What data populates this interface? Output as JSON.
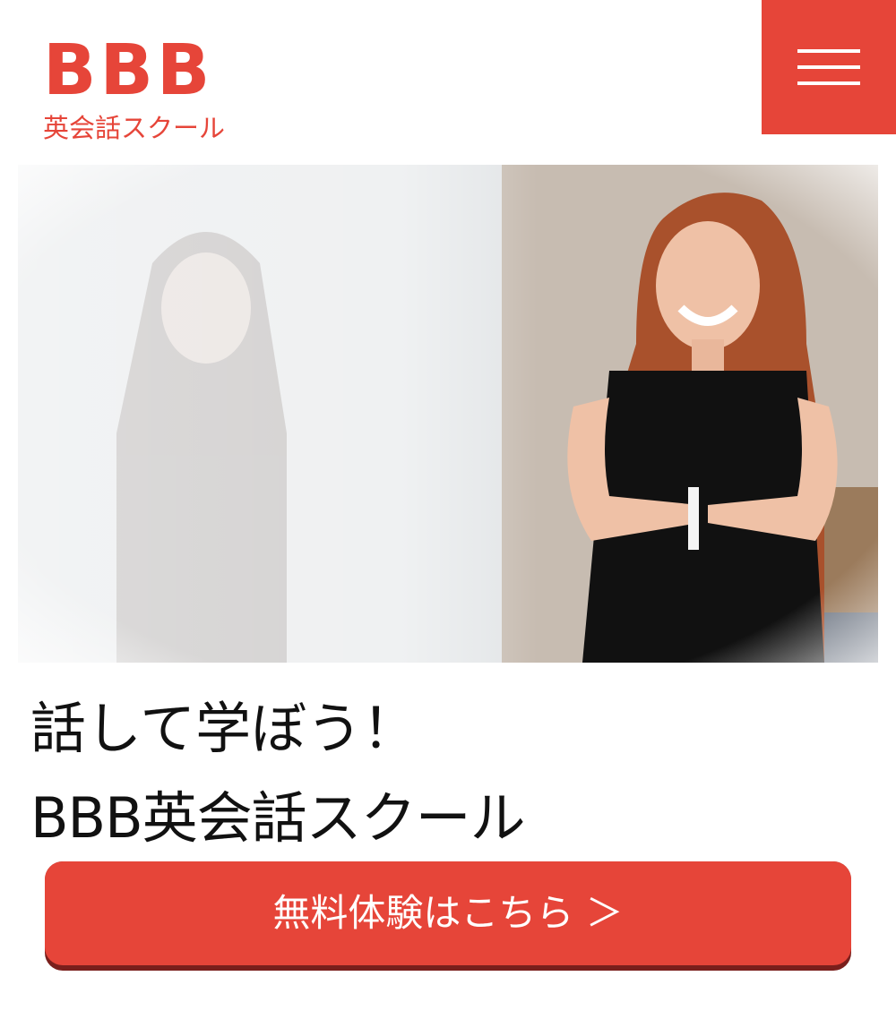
{
  "header": {
    "logo_text": "BBB",
    "logo_subtitle": "英会話スクール",
    "menu_icon": "hamburger-icon"
  },
  "hero": {
    "image_description_icon": "hero-photo"
  },
  "headline": {
    "line1": "話して学ぼう！",
    "line2": "BBB英会話スクール"
  },
  "cta": {
    "label": "無料体験はこちら ＞"
  },
  "colors": {
    "brand": "#e64539",
    "brand_dark": "#7a1f1c",
    "text": "#111111",
    "background": "#ffffff"
  }
}
